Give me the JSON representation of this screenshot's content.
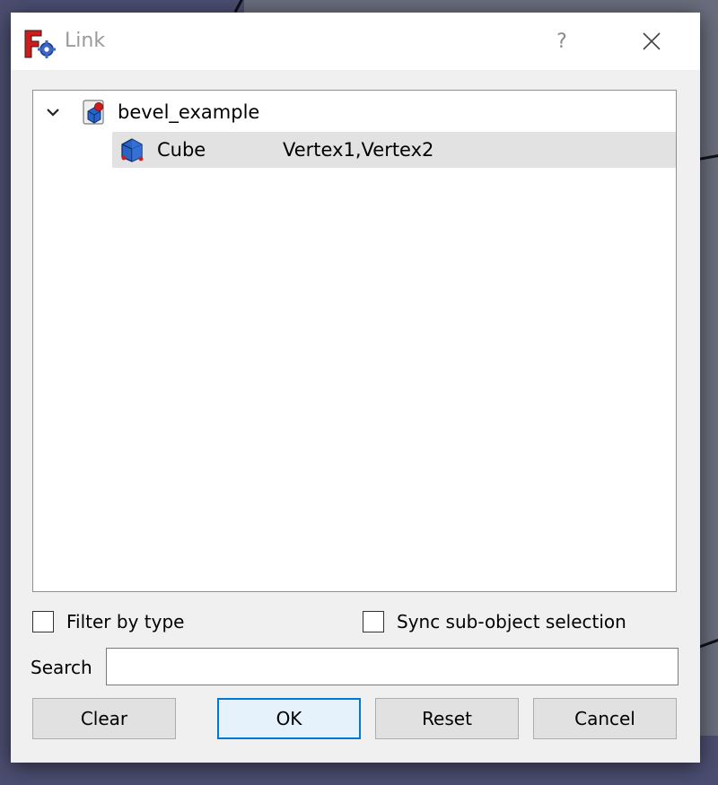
{
  "window": {
    "title": "Link",
    "help_glyph": "?",
    "close_glyph": "×"
  },
  "tree": {
    "root": {
      "label": "bevel_example",
      "icon": "document-part-icon",
      "expanded": true
    },
    "children": [
      {
        "label": "Cube",
        "subelements": "Vertex1,Vertex2",
        "icon": "cube-icon",
        "selected": true
      }
    ]
  },
  "options": {
    "filter_by_type": {
      "label": "Filter by type",
      "checked": false
    },
    "sync_subobject": {
      "label": "Sync sub-object selection",
      "checked": false
    }
  },
  "search": {
    "label": "Search",
    "value": ""
  },
  "buttons": {
    "clear": "Clear",
    "ok": "OK",
    "reset": "Reset",
    "cancel": "Cancel"
  },
  "colors": {
    "selection_bg": "#e2e2e2",
    "default_button_border": "#0078d7",
    "app_icon_red": "#d11a1a",
    "cube_blue": "#2a63c8"
  }
}
